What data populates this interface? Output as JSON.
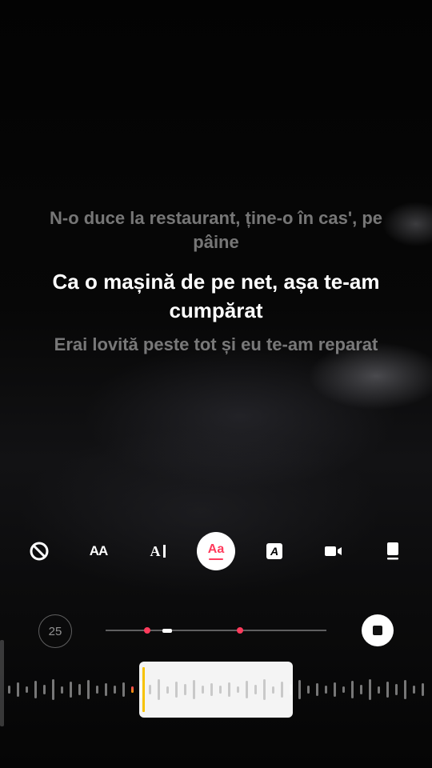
{
  "lyrics": {
    "previous": "N-o duce la restaurant, ține-o în cas', pe pâine",
    "current": "Ca o mașină de pe net, așa te-am cumpărat",
    "next": "Erai lovită peste tot și eu te-am reparat"
  },
  "toolbar": {
    "tools": [
      {
        "icon": "no-style-icon"
      },
      {
        "icon": "text-size-icon",
        "label": "AA"
      },
      {
        "icon": "text-cursor-icon",
        "label": "A"
      },
      {
        "icon": "text-color-icon",
        "label": "Aa",
        "selected": true
      },
      {
        "icon": "text-background-icon",
        "label": "A"
      },
      {
        "icon": "video-icon"
      },
      {
        "icon": "sticker-position-icon"
      }
    ]
  },
  "scrubber": {
    "clip_count": "25",
    "stop_icon": "stop-icon",
    "position": 0.28,
    "markers": [
      0.19,
      0.61
    ]
  },
  "colors": {
    "accent": "#ff3b5c",
    "cursor": "#f7c300",
    "selected_tool_bg": "#ffffff"
  }
}
